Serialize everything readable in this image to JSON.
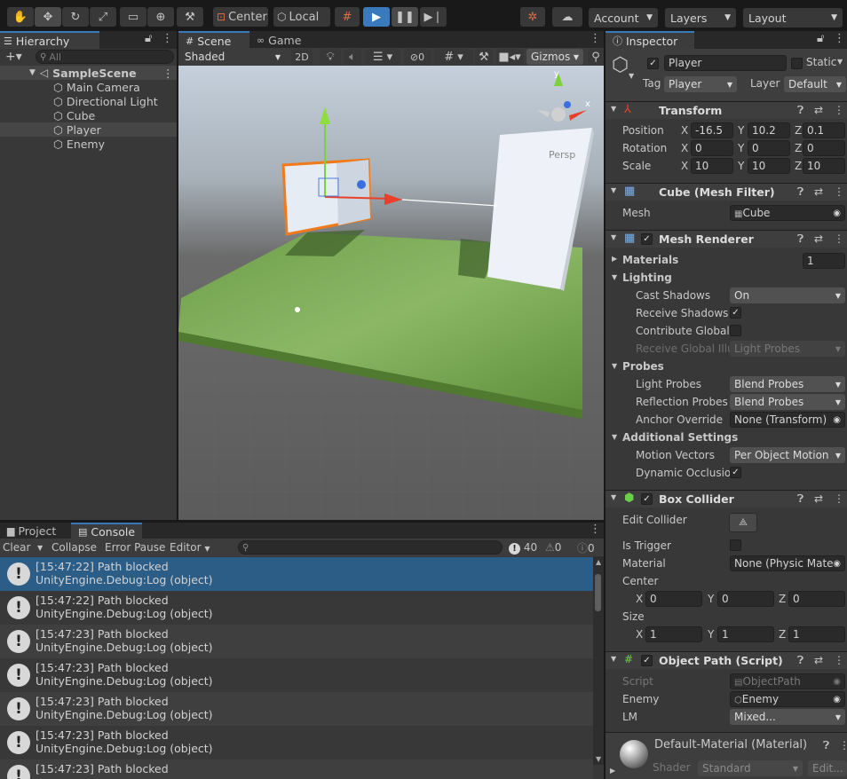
{
  "toolbar": {
    "pivot": "Center",
    "space": "Local",
    "account": "Account",
    "layers": "Layers",
    "layout": "Layout"
  },
  "hierarchy": {
    "tab": "Hierarchy",
    "search_placeholder": "All",
    "scene": "SampleScene",
    "items": [
      "Main Camera",
      "Directional Light",
      "Cube",
      "Player",
      "Enemy"
    ]
  },
  "scene_view": {
    "tab_scene": "Scene",
    "tab_game": "Game",
    "shading": "Shaded",
    "mode_2d": "2D",
    "hidden_count": "0",
    "gizmos": "Gizmos",
    "persp": "Persp",
    "axis_y": "y",
    "axis_x": "x"
  },
  "console": {
    "tab_project": "Project",
    "tab_console": "Console",
    "clear": "Clear",
    "collapse": "Collapse",
    "error_pause": "Error Pause",
    "editor": "Editor",
    "count_log": "40",
    "count_warn": "0",
    "count_err": "0",
    "entries": [
      {
        "line1": "[15:47:22] Path blocked",
        "line2": "UnityEngine.Debug:Log (object)"
      },
      {
        "line1": "[15:47:22] Path blocked",
        "line2": "UnityEngine.Debug:Log (object)"
      },
      {
        "line1": "[15:47:23] Path blocked",
        "line2": "UnityEngine.Debug:Log (object)"
      },
      {
        "line1": "[15:47:23] Path blocked",
        "line2": "UnityEngine.Debug:Log (object)"
      },
      {
        "line1": "[15:47:23] Path blocked",
        "line2": "UnityEngine.Debug:Log (object)"
      },
      {
        "line1": "[15:47:23] Path blocked",
        "line2": "UnityEngine.Debug:Log (object)"
      },
      {
        "line1": "[15:47:23] Path blocked",
        "line2": ""
      }
    ]
  },
  "inspector": {
    "tab": "Inspector",
    "object_name": "Player",
    "static_label": "Static",
    "tag_label": "Tag",
    "tag_value": "Player",
    "layer_label": "Layer",
    "layer_value": "Default",
    "transform": {
      "title": "Transform",
      "position_label": "Position",
      "rotation_label": "Rotation",
      "scale_label": "Scale",
      "position": {
        "x": "-16.5",
        "y": "10.2",
        "z": "0.1"
      },
      "rotation": {
        "x": "0",
        "y": "0",
        "z": "0"
      },
      "scale": {
        "x": "10",
        "y": "10",
        "z": "10"
      }
    },
    "mesh_filter": {
      "title": "Cube (Mesh Filter)",
      "mesh_label": "Mesh",
      "mesh_value": "Cube"
    },
    "mesh_renderer": {
      "title": "Mesh Renderer",
      "materials_label": "Materials",
      "materials_count": "1",
      "lighting_label": "Lighting",
      "cast_shadows_label": "Cast Shadows",
      "cast_shadows_value": "On",
      "receive_shadows_label": "Receive Shadows",
      "contribute_gi_label": "Contribute Global I",
      "receive_gi_label": "Receive Global Illu",
      "receive_gi_value": "Light Probes",
      "probes_label": "Probes",
      "light_probes_label": "Light Probes",
      "light_probes_value": "Blend Probes",
      "reflection_probes_label": "Reflection Probes",
      "reflection_probes_value": "Blend Probes",
      "anchor_override_label": "Anchor Override",
      "anchor_override_value": "None (Transform)",
      "additional_label": "Additional Settings",
      "motion_vectors_label": "Motion Vectors",
      "motion_vectors_value": "Per Object Motion",
      "dynamic_occlusion_label": "Dynamic Occlusio"
    },
    "box_collider": {
      "title": "Box Collider",
      "edit_label": "Edit Collider",
      "is_trigger_label": "Is Trigger",
      "material_label": "Material",
      "material_value": "None (Physic Mater",
      "center_label": "Center",
      "center": {
        "x": "0",
        "y": "0",
        "z": "0"
      },
      "size_label": "Size",
      "size": {
        "x": "1",
        "y": "1",
        "z": "1"
      }
    },
    "object_path": {
      "title": "Object Path (Script)",
      "script_label": "Script",
      "script_value": "ObjectPath",
      "enemy_label": "Enemy",
      "enemy_value": "Enemy",
      "lm_label": "LM",
      "lm_value": "Mixed..."
    },
    "material": {
      "name": "Default-Material (Material)",
      "shader_label": "Shader",
      "shader_value": "Standard",
      "edit_label": "Edit..."
    }
  }
}
